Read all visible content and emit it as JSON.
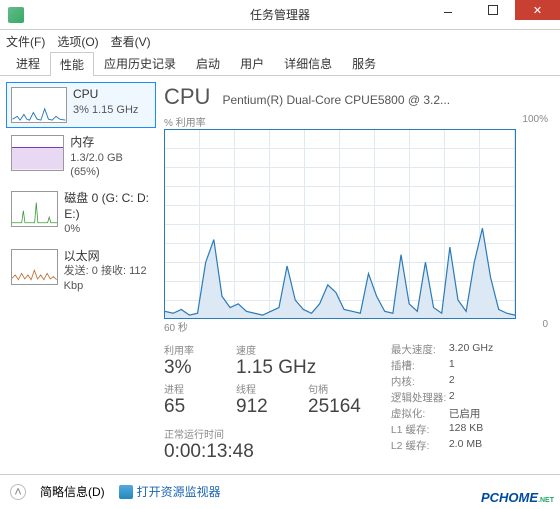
{
  "window": {
    "title": "任务管理器"
  },
  "menu": {
    "file": "文件(F)",
    "options": "选项(O)",
    "view": "查看(V)"
  },
  "tabs": [
    "进程",
    "性能",
    "应用历史记录",
    "启动",
    "用户",
    "详细信息",
    "服务"
  ],
  "sidebar": {
    "items": [
      {
        "name": "CPU",
        "sub": "3% 1.15 GHz",
        "color": "#2a7ab8"
      },
      {
        "name": "内存",
        "sub": "1.3/2.0 GB (65%)",
        "color": "#7c3cb0"
      },
      {
        "name": "磁盘 0 (G: C: D: E:)",
        "sub": "0%",
        "color": "#3a9c3a"
      },
      {
        "name": "以太网",
        "sub": "发送: 0 接收: 112 Kbp",
        "color": "#b86a2a"
      }
    ]
  },
  "main": {
    "title": "CPU",
    "subtitle": "Pentium(R) Dual-Core CPUE5800 @ 3.2...",
    "ylabel": "% 利用率",
    "ymax": "100%",
    "xleft": "60 秒",
    "xright": "0",
    "stats_row1": [
      {
        "lbl": "利用率",
        "val": "3%"
      },
      {
        "lbl": "速度",
        "val": "1.15 GHz"
      }
    ],
    "stats_row2": [
      {
        "lbl": "进程",
        "val": "65"
      },
      {
        "lbl": "线程",
        "val": "912"
      },
      {
        "lbl": "句柄",
        "val": "25164"
      }
    ],
    "uptime_lbl": "正常运行时间",
    "uptime_val": "0:00:13:48",
    "right": [
      {
        "k": "最大速度:",
        "v": "3.20 GHz"
      },
      {
        "k": "插槽:",
        "v": "1"
      },
      {
        "k": "内核:",
        "v": "2"
      },
      {
        "k": "逻辑处理器:",
        "v": "2"
      },
      {
        "k": "虚拟化:",
        "v": "已启用"
      },
      {
        "k": "L1 缓存:",
        "v": "128 KB"
      },
      {
        "k": "L2 缓存:",
        "v": "2.0 MB"
      }
    ]
  },
  "footer": {
    "less": "简略信息(D)",
    "resmon": "打开资源监视器"
  },
  "watermark": "PCHOME",
  "watermark_net": ".NET",
  "chart_data": {
    "type": "line",
    "title": "CPU % 利用率",
    "xlabel": "秒",
    "ylabel": "% 利用率",
    "ylim": [
      0,
      100
    ],
    "xlim": [
      60,
      0
    ],
    "series": [
      {
        "name": "CPU",
        "values": [
          4,
          3,
          5,
          2,
          3,
          30,
          42,
          12,
          6,
          8,
          4,
          3,
          2,
          4,
          6,
          28,
          10,
          5,
          3,
          8,
          18,
          14,
          5,
          4,
          3,
          24,
          12,
          4,
          3,
          34,
          8,
          4,
          30,
          6,
          3,
          38,
          10,
          4,
          30,
          48,
          22,
          5,
          3,
          2
        ]
      }
    ]
  }
}
